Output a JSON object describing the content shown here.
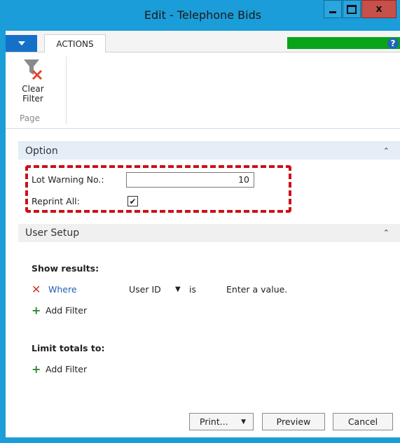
{
  "window": {
    "title": "Edit - Telephone Bids",
    "accent_color": "#1b9dd9"
  },
  "ribbon": {
    "tabs": [
      "ACTIONS"
    ],
    "actions": [
      {
        "label_line1": "Clear",
        "label_line2": "Filter",
        "icon": "clear-filter-icon"
      }
    ],
    "group_label": "Page"
  },
  "option": {
    "header": "Option",
    "fields": {
      "lot_warning_label": "Lot Warning No.:",
      "lot_warning_value": "10",
      "reprint_all_label": "Reprint All:",
      "reprint_all_checked": true
    },
    "highlight_color": "#cc1018"
  },
  "user_setup": {
    "header": "User Setup",
    "show_results_label": "Show results:",
    "filter": {
      "where": "Where",
      "field": "User ID",
      "operator": "is",
      "value_placeholder": "Enter a value."
    },
    "add_filter_label": "Add Filter",
    "limit_totals_label": "Limit totals to:",
    "add_filter_label_2": "Add Filter"
  },
  "buttons": {
    "print": "Print...",
    "preview": "Preview",
    "cancel": "Cancel"
  }
}
